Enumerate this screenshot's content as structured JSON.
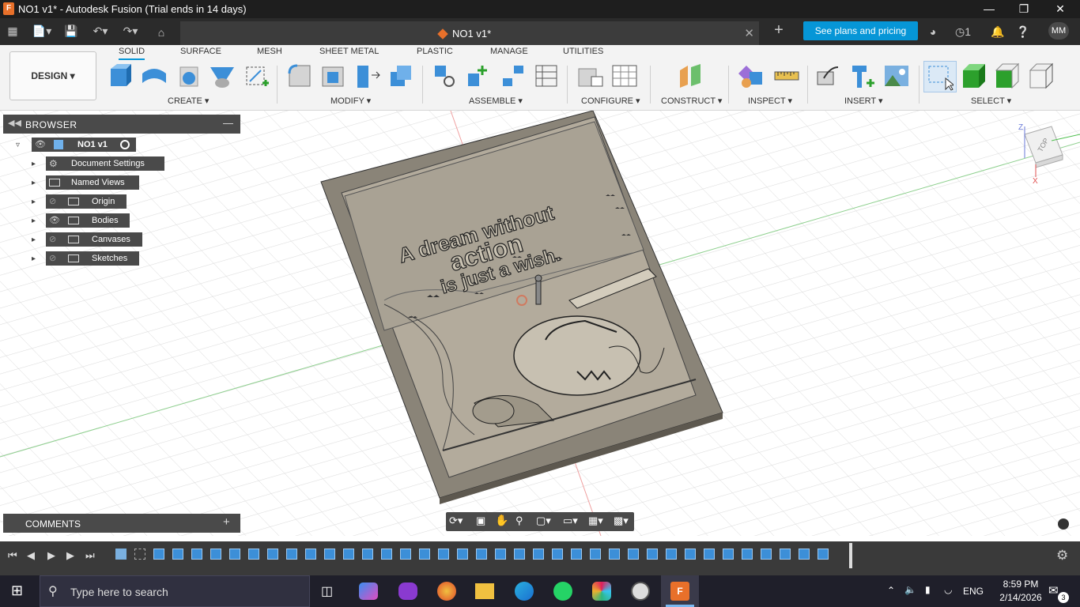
{
  "window": {
    "title": "NO1 v1* - Autodesk Fusion (Trial ends in 14 days)",
    "app_icon": "F"
  },
  "tabs": {
    "doc_tab": "NO1 v1*",
    "plans_button": "See plans and pricing",
    "jobs_count": "1",
    "user_initials": "MM"
  },
  "toolbar": {
    "design_button": "DESIGN",
    "workspace_tabs": [
      "SOLID",
      "SURFACE",
      "MESH",
      "SHEET METAL",
      "PLASTIC",
      "MANAGE",
      "UTILITIES"
    ],
    "groups": [
      "CREATE",
      "MODIFY",
      "ASSEMBLE",
      "CONFIGURE",
      "CONSTRUCT",
      "INSPECT",
      "INSERT",
      "SELECT"
    ]
  },
  "browser": {
    "title": "BROWSER",
    "root": "NO1 v1",
    "items": [
      "Document Settings",
      "Named Views",
      "Origin",
      "Bodies",
      "Canvases",
      "Sketches"
    ]
  },
  "comments": {
    "title": "COMMENTS"
  },
  "viewcube": {
    "face": "TOP",
    "axis_z": "Z",
    "axis_x": "X"
  },
  "model_text": {
    "line1": "A dream without",
    "line2": "action",
    "line3": "is just a wish."
  },
  "taskbar": {
    "search_placeholder": "Type here to search",
    "time": "8:59 PM",
    "date": "2/14/2026",
    "lang": "ENG",
    "notif_count": "3"
  }
}
